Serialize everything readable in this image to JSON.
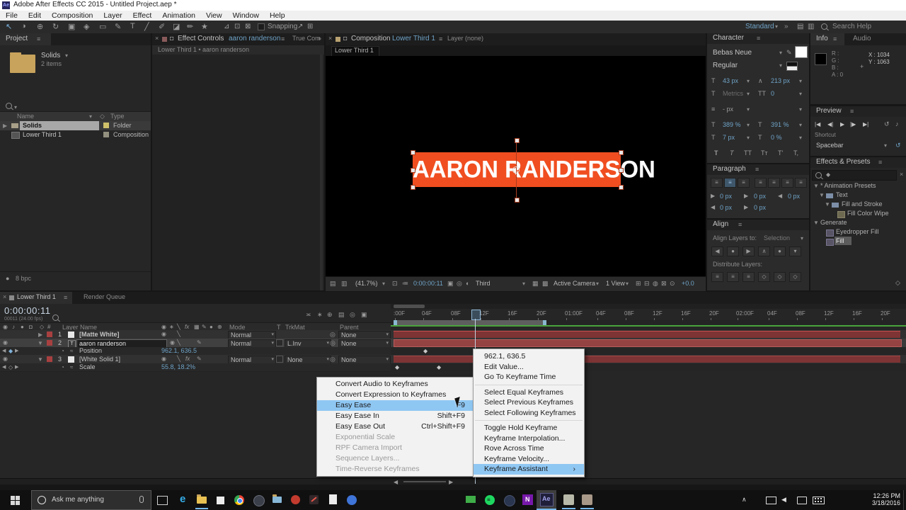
{
  "colors": {
    "accent_blue": "#6fa3c7",
    "banner_orange": "#F04E20",
    "menu_highlight": "#8fc7f3",
    "layer_bar_red": "#7e3434"
  },
  "icons": {
    "panel_menu": "≡",
    "chevron_down": "▾",
    "collapse": "▼",
    "expand": "▶",
    "close": "×",
    "overflow": "»",
    "submenu_arrow": "›",
    "eye": "◉",
    "audio_note": "♪",
    "solo": "●",
    "lock": "◘",
    "stopwatch": "◔",
    "pickwhip": "◎",
    "keyframe": "◆",
    "keyframe_open": "◇",
    "nav_prev": "◀",
    "nav_next": "▶",
    "reset": "↺",
    "tray_up": "∧",
    "graph": "≈",
    "bullet": "•",
    "star": "*"
  },
  "app": {
    "icon_text": "Ae",
    "title": "Adobe After Effects CC 2015 - Untitled Project.aep *",
    "menu": [
      "File",
      "Edit",
      "Composition",
      "Layer",
      "Effect",
      "Animation",
      "View",
      "Window",
      "Help"
    ]
  },
  "toolbar": {
    "tools": [
      "↖",
      "◑",
      "⊕",
      "↻",
      "▣",
      "◈",
      "▭",
      "✎",
      "T",
      "╱",
      "✐",
      "◪",
      "✏",
      "★"
    ],
    "extra_tools": [
      "⊿",
      "⊡",
      "⊠"
    ],
    "post_snap_tools": [
      "↗",
      "⊞"
    ],
    "snapping": "Snapping",
    "workspace": "Standard",
    "workspace_icons": [
      "▤",
      "▥"
    ],
    "search_help": "Search Help"
  },
  "project": {
    "tab": "Project",
    "item_name": "Solids",
    "item_count": "2 items",
    "col_name": "Name",
    "col_type": "Type",
    "rows": [
      {
        "name": "Solids",
        "type": "Folder"
      },
      {
        "name": "Lower Third 1",
        "type": "Composition"
      }
    ],
    "bit_depth": "8 bpc"
  },
  "effect_controls": {
    "tab_label": "Effect Controls",
    "tab_target": "aaron randerson",
    "tab2": "True Com",
    "breadcrumb": "Lower Third 1 • aaron randerson"
  },
  "composition": {
    "tab_label": "Composition",
    "tab_target": "Lower Third 1",
    "tab2": "Layer (none)",
    "subtab": "Lower Third 1",
    "banner_text": "AARON RANDERSON",
    "statusbar": {
      "zoom": "(41.7%)",
      "timecode": "0:00:00:11",
      "resolution": "Third",
      "camera": "Active Camera",
      "view": "1 View",
      "exposure": "+0.0",
      "icons": [
        "▤",
        "▥",
        "⊡",
        "≔",
        "▣",
        "◎",
        "◐",
        "▦",
        "▩",
        "⊞",
        "⊟",
        "◍",
        "⊠",
        "⊙",
        "◧"
      ]
    }
  },
  "character": {
    "title": "Character",
    "font": "Bebas Neue",
    "style": "Regular",
    "size": "43 px",
    "leading": "213 px",
    "kerning": "Metrics",
    "tracking": "0",
    "stroke_width": "- px",
    "vscale": "389 %",
    "hscale": "391 %",
    "baseline": "7 px",
    "tsume": "0 %",
    "glyph_row": [
      "T",
      "T",
      "TT",
      "Tᴛ",
      "T'",
      "T,"
    ]
  },
  "paragraph": {
    "title": "Paragraph",
    "indent_left": "0 px",
    "indent_first": "0 px",
    "indent_right": "0 px",
    "space_before": "0 px",
    "space_after": "0 px"
  },
  "align_panel": {
    "title": "Align",
    "layers_to_label": "Align Layers to:",
    "layers_to_value": "Selection",
    "distribute_label": "Distribute Layers:"
  },
  "info": {
    "tab": "Info",
    "tab2": "Audio",
    "r": "R :",
    "g": "G :",
    "b": "B :",
    "a": "A : 0",
    "x": "X : 1034",
    "y": "Y : 1063"
  },
  "preview": {
    "title": "Preview",
    "buttons": [
      "|◀",
      "◀|",
      "▶",
      "|▶",
      "▶|"
    ],
    "shortcut_label": "Shortcut",
    "shortcut_value": "Spacebar"
  },
  "effects_presets": {
    "title": "Effects & Presets",
    "tree": [
      {
        "label": "* Animation Presets"
      },
      {
        "label": "Text"
      },
      {
        "label": "Fill and Stroke"
      },
      {
        "label": "Fill Color Wipe"
      },
      {
        "label": "Generate"
      },
      {
        "label": "Eyedropper Fill"
      },
      {
        "label": "Fill"
      }
    ]
  },
  "timeline": {
    "tab": "Lower Third 1",
    "tab2": "Render Queue",
    "timecode": "0:00:00:11",
    "timecode_sub": "00011 (24.00 fps)",
    "col_layer_name": "Layer Name",
    "col_mode": "Mode",
    "col_t": "T",
    "col_trkmat": "TrkMat",
    "col_parent": "Parent",
    "header_icons": [
      "≍",
      "∗",
      "⊕",
      "▤",
      "◎",
      "▣"
    ],
    "switch_icons": [
      "◉",
      "∗",
      "╲",
      "fx",
      "▦",
      "✎",
      "●",
      "⊕"
    ],
    "layers": [
      {
        "num": "1",
        "name": "[Matte White]",
        "mode": "Normal",
        "trkmat": "",
        "parent": "None"
      },
      {
        "num": "2",
        "name": "aaron randerson",
        "mode": "Normal",
        "trkmat": "L.Inv",
        "parent": "None"
      },
      {
        "num": "3",
        "name": "[White Solid 1]",
        "mode": "Normal",
        "trkmat": "None",
        "parent": "None"
      }
    ],
    "properties": [
      {
        "name": "Position",
        "value": "962.1, 636.5"
      },
      {
        "name": "Scale",
        "value": "55.8, 18.2%"
      }
    ],
    "ruler_ticks": [
      ":00F",
      "04F",
      "08F",
      "12F",
      "16F",
      "20F",
      "01:00F",
      "04F",
      "08F",
      "12F",
      "16F",
      "20F",
      "02:00F",
      "04F",
      "08F",
      "12F",
      "16F",
      "20F"
    ]
  },
  "context_menu": {
    "items": [
      {
        "label": "962.1, 636.5"
      },
      {
        "label": "Edit Value..."
      },
      {
        "label": "Go To Keyframe Time"
      },
      {
        "label": "Select Equal Keyframes"
      },
      {
        "label": "Select Previous Keyframes"
      },
      {
        "label": "Select Following Keyframes"
      },
      {
        "label": "Toggle Hold Keyframe"
      },
      {
        "label": "Keyframe Interpolation..."
      },
      {
        "label": "Rove Across Time"
      },
      {
        "label": "Keyframe Velocity..."
      },
      {
        "label": "Keyframe Assistant"
      }
    ]
  },
  "submenu": {
    "items": [
      {
        "label": "Convert Audio to Keyframes",
        "shortcut": ""
      },
      {
        "label": "Convert Expression to Keyframes",
        "shortcut": ""
      },
      {
        "label": "Easy Ease",
        "shortcut": "F9"
      },
      {
        "label": "Easy Ease In",
        "shortcut": "Shift+F9"
      },
      {
        "label": "Easy Ease Out",
        "shortcut": "Ctrl+Shift+F9"
      },
      {
        "label": "Exponential Scale",
        "shortcut": ""
      },
      {
        "label": "RPF Camera Import",
        "shortcut": ""
      },
      {
        "label": "Sequence Layers...",
        "shortcut": ""
      },
      {
        "label": "Time-Reverse Keyframes",
        "shortcut": ""
      }
    ]
  },
  "taskbar": {
    "search_placeholder": "Ask me anything",
    "edge_letter": "e",
    "onenote_letter": "N",
    "ae_letter": "Ae",
    "time": "12:26 PM",
    "date": "3/18/2016"
  }
}
